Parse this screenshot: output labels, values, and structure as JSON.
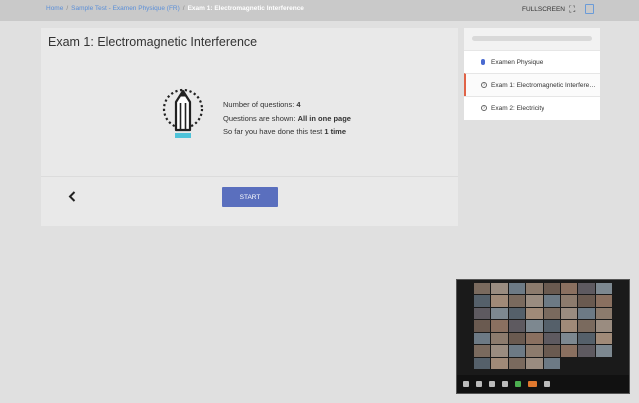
{
  "breadcrumb": {
    "items": [
      "Home",
      "Sample Test - Examen Physique (FR)"
    ],
    "current": "Exam 1: Electromagnetic Interference",
    "separator": "/"
  },
  "toolbar": {
    "fullscreen_label": "FULLSCREEN"
  },
  "exam": {
    "title": "Exam 1: Electromagnetic Interference",
    "questions_label": "Number of questions:",
    "questions_value": "4",
    "shown_label": "Questions are shown:",
    "shown_value": "All in one page",
    "done_label": "So far you have done this test",
    "done_value": "1 time",
    "start_label": "START"
  },
  "sidebar": {
    "items": [
      {
        "label": "Examen Physique",
        "icon": "microphone-icon"
      },
      {
        "label": "Exam 1: Electromagnetic Interference",
        "icon": "question-circle-icon",
        "active": true
      },
      {
        "label": "Exam 2: Electricity",
        "icon": "question-circle-icon"
      }
    ]
  },
  "colors": {
    "accent": "#5a6fbe",
    "active_marker": "#e06347",
    "link": "#5b8fd8",
    "pencil_accent": "#4fc3d9"
  }
}
